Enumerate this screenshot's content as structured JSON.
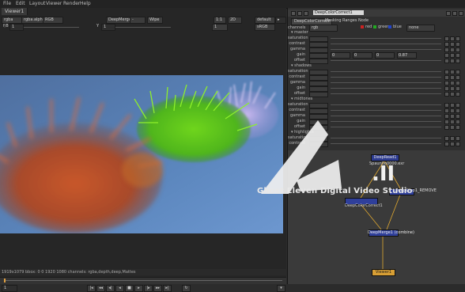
{
  "menu": {
    "items": [
      "File",
      "Edit",
      "Layout",
      "Viewer",
      "Render",
      "Help"
    ]
  },
  "viewer": {
    "tab_label": "Viewer1",
    "toolbar": {
      "channels": "rgba",
      "layer": "rgba.alpha",
      "colorspace": "RGB",
      "input_a": "DeepMerge1",
      "input_b": "-",
      "ab_mode": "Wipe",
      "zoom": "1:1",
      "proxy": "2D",
      "lut": "default",
      "gain_label": "f/8",
      "gain_value": "1",
      "gamma_label": "Y",
      "gamma_value": "1",
      "proxy_scale": "sRGB",
      "frame": "1"
    },
    "info": "1919x1079 bbox: 0 0 1920 1080 channels: rgba,depth,deep,Mattes",
    "transport": {
      "frame_field": "1"
    }
  },
  "properties": {
    "node_name": "DeepColorCorrect1",
    "tabs": [
      "DeepColorCorrect",
      "Masking",
      "Ranges",
      "Node"
    ],
    "channels_label": "channels",
    "channels_value": "rgb",
    "channel_red": "red",
    "channel_green": "green",
    "channel_blue": "blue",
    "channel_none": "none",
    "sections": [
      {
        "name": "master",
        "params": [
          "saturation",
          "contrast",
          "gamma",
          "gain",
          "offset"
        ]
      },
      {
        "name": "shadows",
        "params": [
          "saturation",
          "contrast",
          "gamma",
          "gain",
          "offset"
        ]
      },
      {
        "name": "midtones",
        "params": [
          "saturation",
          "contrast",
          "gamma",
          "gain",
          "offset"
        ]
      },
      {
        "name": "highlights",
        "params": [
          "saturation",
          "contrast"
        ]
      }
    ],
    "gain_values": [
      "0",
      "0",
      "0",
      "0.87"
    ]
  },
  "graph": {
    "nodes": {
      "deep_read": "DeepRead1",
      "deep_read_file": "Spaun0o0000.exr",
      "deep_reformat": "DeepCrop1_REMOVE",
      "deep_cc": "DeepColorCorrect1",
      "deep_merge": "DeepMerge1 (combine)",
      "viewer": "Viewer1"
    }
  },
  "watermark": {
    "text": "Ghost Eleven Digital Video Studio",
    "logo_suffix": ".II"
  },
  "colors": {
    "accent_orange": "#d89f35",
    "node_blue": "#2f3f9a",
    "bg_sky": "#5a7fb0"
  }
}
